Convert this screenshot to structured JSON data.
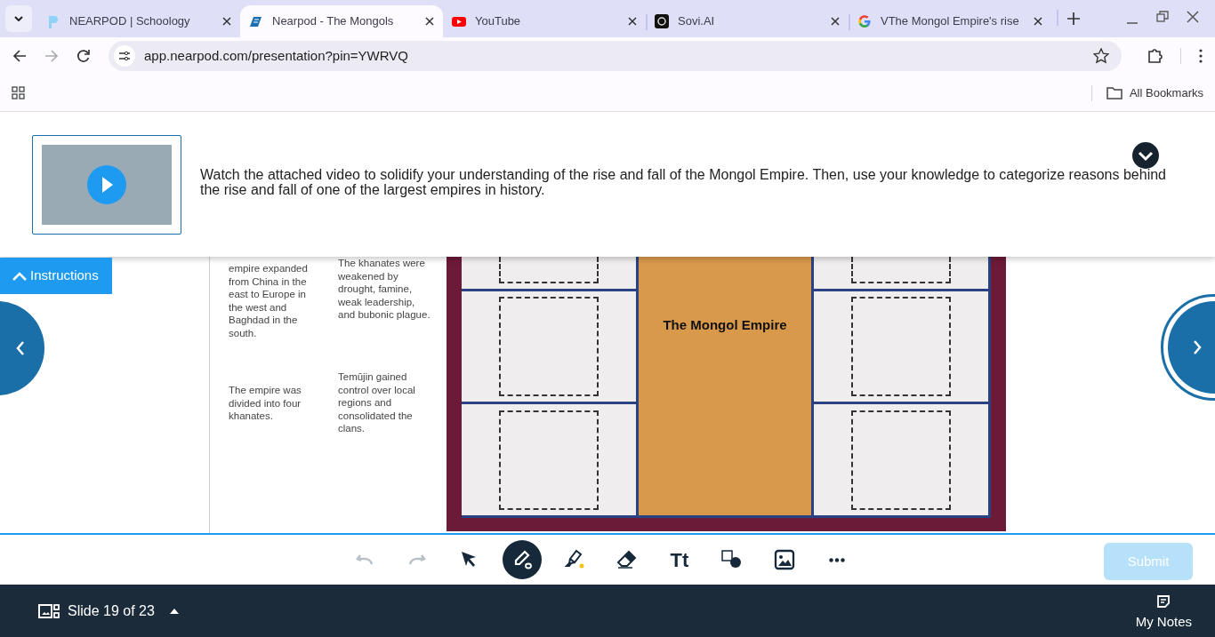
{
  "browser": {
    "tabs": [
      {
        "title": "NEARPOD | Schoology",
        "selected": false
      },
      {
        "title": "Nearpod - The Mongols",
        "selected": true
      },
      {
        "title": "YouTube",
        "selected": false
      },
      {
        "title": "Sovi.AI",
        "selected": false
      },
      {
        "title": "VThe Mongol Empire's rise",
        "selected": false
      }
    ],
    "address": "app.nearpod.com/presentation?pin=YWRVQ",
    "bookmarks": "All Bookmarks"
  },
  "instructions": {
    "text": "Watch the attached video to solidify your understanding of the rise and fall of the Mongol Empire. Then, use your knowledge to categorize reasons behind the rise and fall of one of the largest empires in history.",
    "toggle": "Instructions",
    "expanded": true
  },
  "slide": {
    "cards": [
      {
        "text": "empire expanded from China in the east to Europe in the west and Baghdad in the south."
      },
      {
        "text": "The empire was divided into four khanates."
      },
      {
        "text": "The khanates were weakened by drought, famine, weak leadership, and bubonic plague."
      },
      {
        "text": "Temūjin gained control over local regions and consolidated the clans."
      }
    ],
    "board_title": "The Mongol Empire"
  },
  "toolbar": [
    {
      "kind": "undo",
      "disabled": true,
      "selected": false
    },
    {
      "kind": "redo",
      "disabled": true,
      "selected": false
    },
    {
      "kind": "select",
      "disabled": false,
      "selected": false
    },
    {
      "kind": "pen",
      "disabled": false,
      "selected": true
    },
    {
      "kind": "highlighter",
      "disabled": false,
      "selected": false
    },
    {
      "kind": "eraser",
      "disabled": false,
      "selected": false
    },
    {
      "kind": "text",
      "label": "Tt",
      "disabled": false,
      "selected": false
    },
    {
      "kind": "shapes",
      "disabled": false,
      "selected": false
    },
    {
      "kind": "image",
      "disabled": false,
      "selected": false
    },
    {
      "kind": "more",
      "disabled": false,
      "selected": false
    }
  ],
  "submit": {
    "label": "Submit",
    "disabled": true
  },
  "footer": {
    "slide": "Slide 19 of 23",
    "notes": "My Notes"
  }
}
